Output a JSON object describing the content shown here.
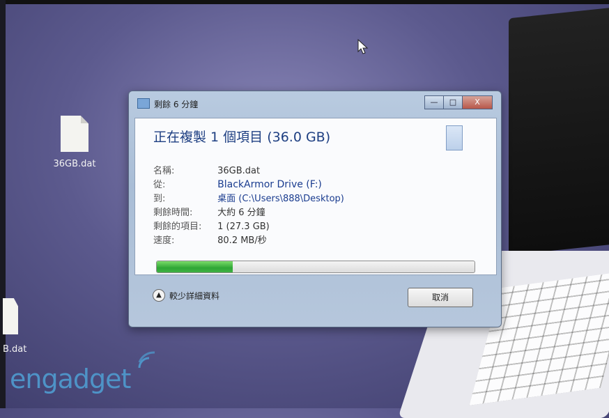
{
  "desktop": {
    "icons": [
      {
        "label": "36GB.dat"
      },
      {
        "label": "B.dat"
      }
    ]
  },
  "dialog": {
    "title": "剩餘 6 分鐘",
    "controls": {
      "minimize": "—",
      "maximize": "□",
      "close": "X"
    },
    "heading": "正在複製 1 個項目 (36.0 GB)",
    "details": [
      {
        "label": "名稱:",
        "value": "36GB.dat"
      },
      {
        "label": "從:",
        "value": "BlackArmor Drive (F:)"
      },
      {
        "label": "到:",
        "value": "桌面 (C:\\Users\\888\\Desktop)"
      },
      {
        "label": "剩餘時間:",
        "value": "大約 6 分鐘"
      },
      {
        "label": "剩餘的項目:",
        "value": "1 (27.3 GB)"
      },
      {
        "label": "速度:",
        "value": "80.2 MB/秒"
      }
    ],
    "progress": 0.24,
    "fewer_details": "較少詳細資料",
    "cancel": "取消"
  },
  "watermark": "engadget",
  "colors": {
    "progress": "#2fa636",
    "heading": "#1e3f82"
  }
}
